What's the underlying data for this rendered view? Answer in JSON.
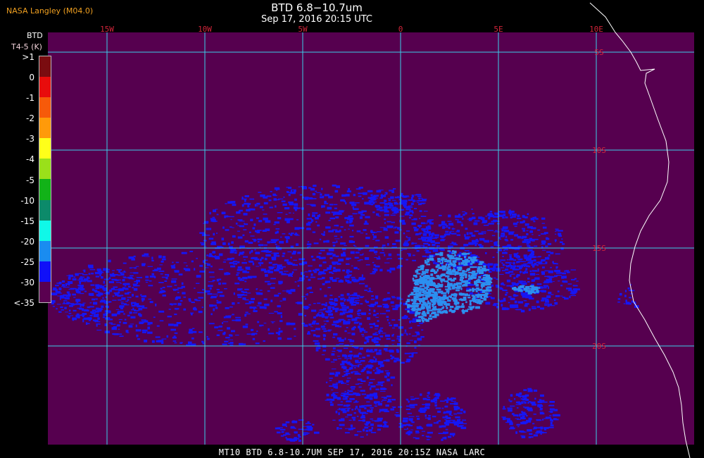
{
  "header": {
    "provider": "NASA Langley (M04.0)",
    "title": "BTD 6.8−10.7um",
    "subtitle": "Sep 17, 2016 20:15 UTC"
  },
  "footer": {
    "caption": "MT10  BTD 6.8-10.7UM  SEP 17, 2016 20:15Z  NASA LARC"
  },
  "legend": {
    "title": "BTD",
    "units": "T4-5 (K)",
    "entries": [
      {
        "label": ">1",
        "color": "#7a0c10"
      },
      {
        "label": "0",
        "color": "#e80c0c"
      },
      {
        "label": "-1",
        "color": "#f65a0a"
      },
      {
        "label": "-2",
        "color": "#ff9a0a"
      },
      {
        "label": "-3",
        "color": "#ffff1a"
      },
      {
        "label": "-4",
        "color": "#9ae01a"
      },
      {
        "label": "-5",
        "color": "#12b218"
      },
      {
        "label": "-10",
        "color": "#0c8a6a"
      },
      {
        "label": "-15",
        "color": "#10f8e8"
      },
      {
        "label": "-20",
        "color": "#1a8cf0"
      },
      {
        "label": "-25",
        "color": "#1010f8"
      },
      {
        "label": "-30",
        "color": "#5a0050"
      },
      {
        "label": "<-35",
        "color": "#5a0050"
      }
    ]
  },
  "map": {
    "background_color": "#56004f",
    "grid_color": "#3ccfe8",
    "label_color": "#d2243a",
    "coast_color": "#ffffff",
    "longitude_labels": [
      "15W",
      "10W",
      "5W",
      "0",
      "5E",
      "10E"
    ],
    "latitude_labels": [
      "5S",
      "10S",
      "15S",
      "20S"
    ]
  }
}
